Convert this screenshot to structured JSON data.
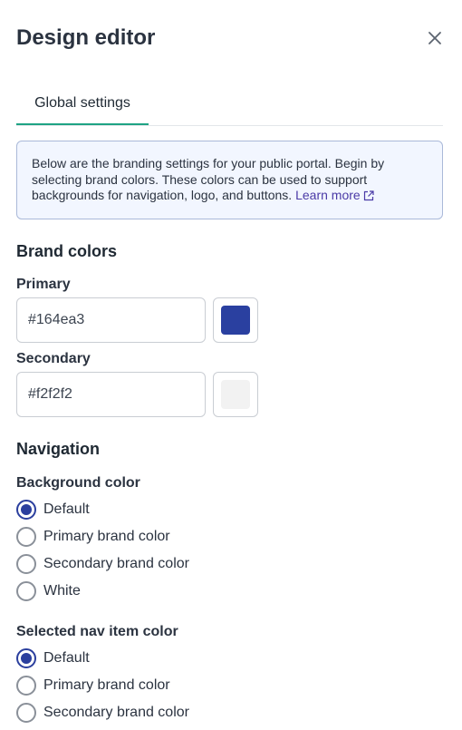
{
  "header": {
    "title": "Design editor"
  },
  "tabs": [
    {
      "label": "Global settings",
      "active": true
    }
  ],
  "info": {
    "text": "Below are the branding settings for your public portal. Begin by selecting brand colors. These colors can be used to support backgrounds for navigation, logo, and buttons.",
    "link_label": "Learn more"
  },
  "brand_colors": {
    "title": "Brand colors",
    "primary": {
      "label": "Primary",
      "value": "#164ea3",
      "swatch_color": "#2a40a0"
    },
    "secondary": {
      "label": "Secondary",
      "value": "#f2f2f2",
      "swatch_color": "#f2f2f2"
    }
  },
  "navigation": {
    "title": "Navigation",
    "background_color": {
      "label": "Background color",
      "options": [
        "Default",
        "Primary brand color",
        "Secondary brand color",
        "White"
      ],
      "selected": "Default"
    },
    "selected_item_color": {
      "label": "Selected nav item color",
      "options": [
        "Default",
        "Primary brand color",
        "Secondary brand color"
      ],
      "selected": "Default"
    }
  },
  "colors": {
    "accent": "#2b3f9e",
    "tab_underline": "#1fa384",
    "link": "#4a3aa6"
  }
}
